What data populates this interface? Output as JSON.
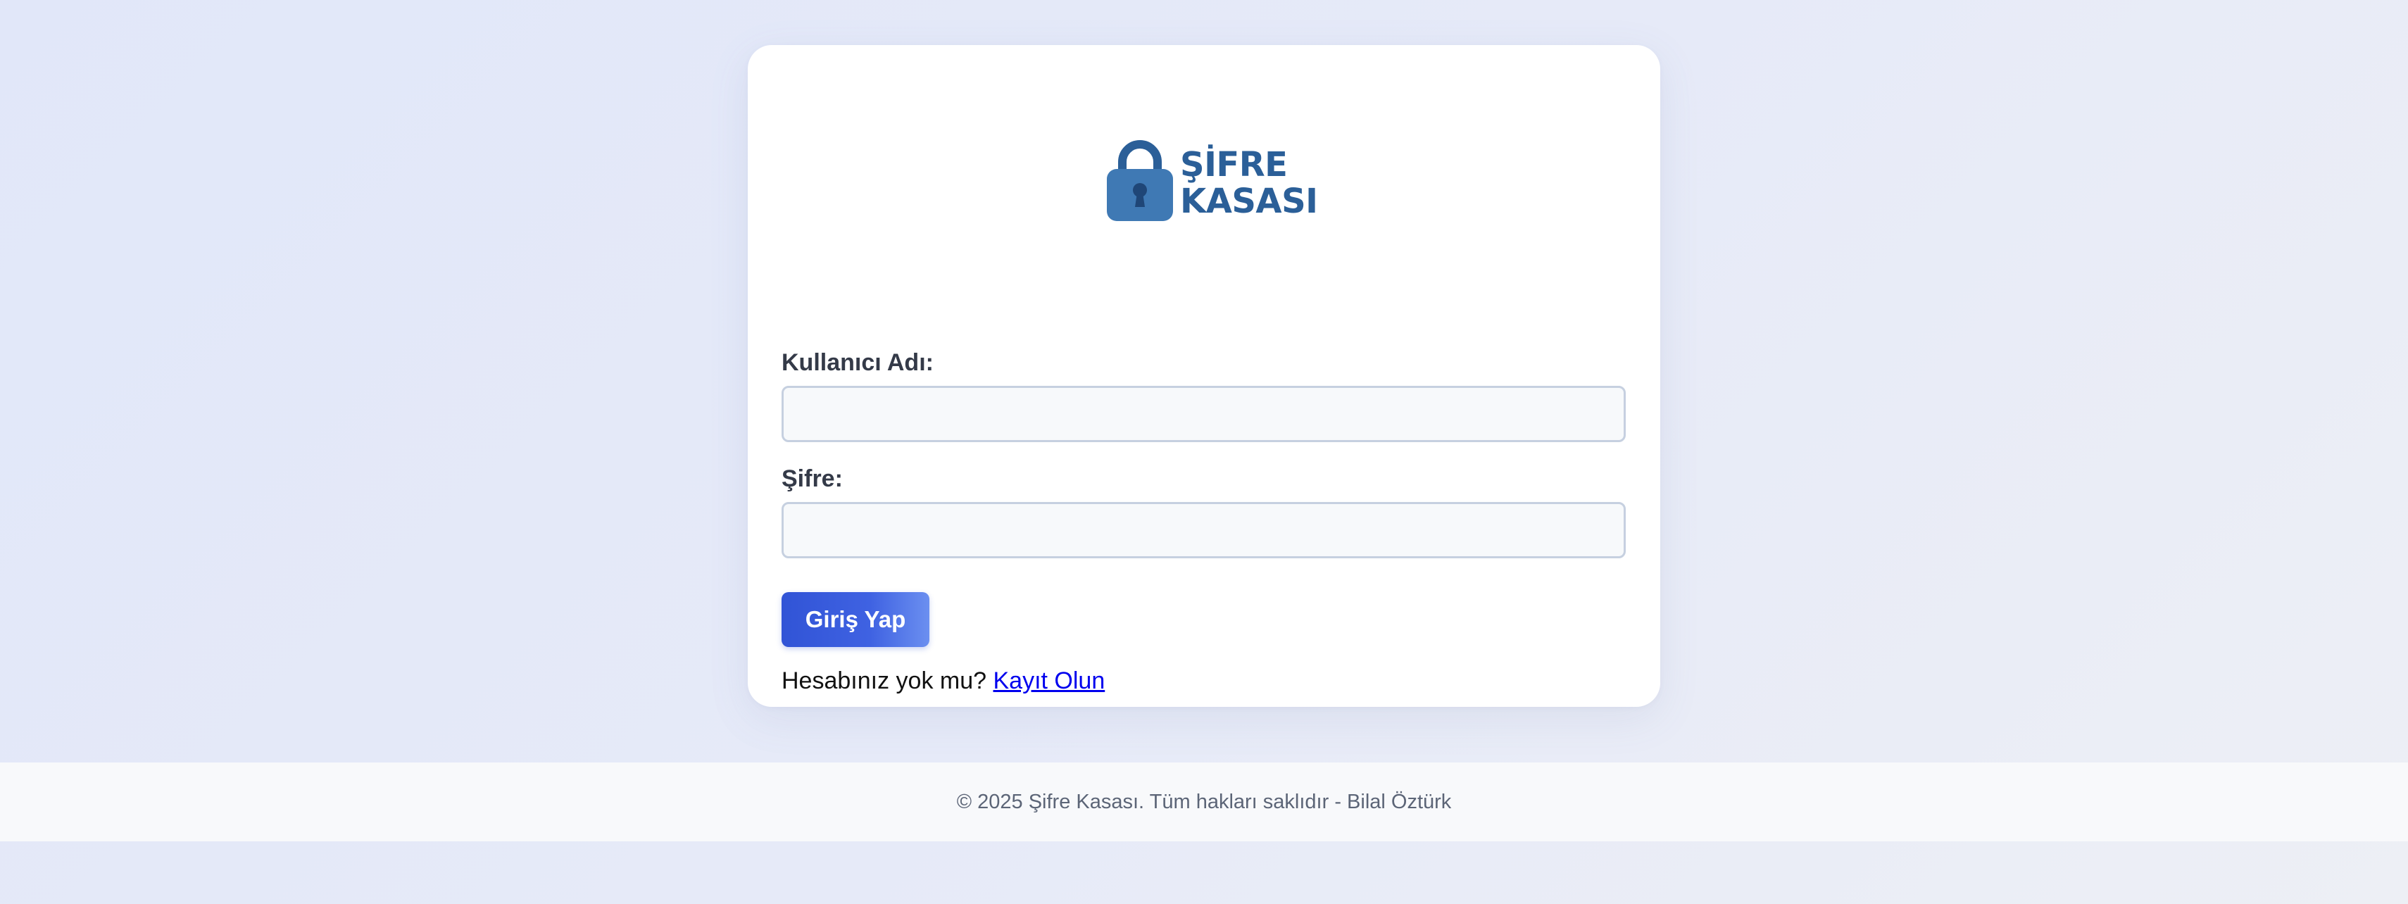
{
  "logo": {
    "line1": "ŞİFRE",
    "line2": "KASASI",
    "icon": "lock-icon",
    "color": "#2b5f98"
  },
  "form": {
    "username_label": "Kullanıcı Adı:",
    "username_value": "",
    "password_label": "Şifre:",
    "password_value": "",
    "submit_label": "Giriş Yap",
    "register_prompt": "Hesabınız yok mu?",
    "register_link": "Kayıt Olun"
  },
  "footer": {
    "text": "© 2025 Şifre Kasası. Tüm hakları saklıdır - Bilal Öztürk"
  },
  "colors": {
    "accent": "#3154d6",
    "link": "#0000ee",
    "background": "#e4e9f8"
  }
}
